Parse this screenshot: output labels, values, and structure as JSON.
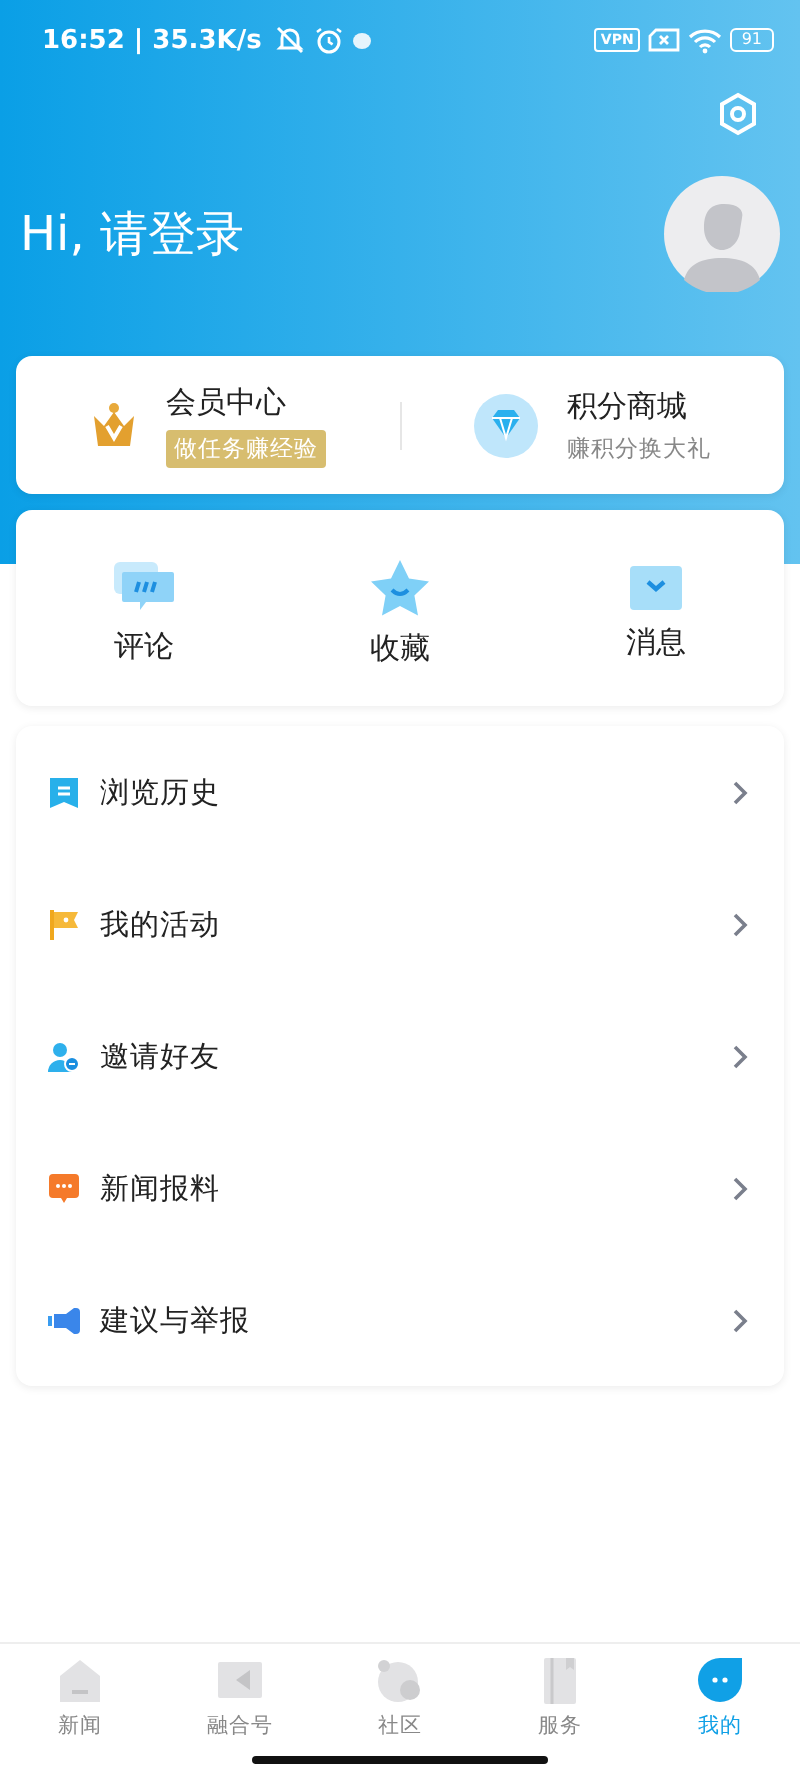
{
  "status_bar": {
    "time": "16:52 | 35.3K/s",
    "vpn": "VPN",
    "battery": "91"
  },
  "header": {
    "greeting": "Hi, 请登录"
  },
  "feature_cards": [
    {
      "kind": "member",
      "title": "会员中心",
      "subtitle": "做任务赚经验"
    },
    {
      "kind": "points",
      "title": "积分商城",
      "subtitle": "赚积分换大礼"
    }
  ],
  "shortcuts": [
    {
      "kind": "comment",
      "label": "评论"
    },
    {
      "kind": "favorite",
      "label": "收藏"
    },
    {
      "kind": "message",
      "label": "消息"
    }
  ],
  "menu": [
    {
      "kind": "history",
      "label": "浏览历史"
    },
    {
      "kind": "activity",
      "label": "我的活动"
    },
    {
      "kind": "invite",
      "label": "邀请好友"
    },
    {
      "kind": "tipoff",
      "label": "新闻报料"
    },
    {
      "kind": "feedback",
      "label": "建议与举报"
    }
  ],
  "bottom_nav": [
    {
      "kind": "news",
      "label": "新闻",
      "selected": false
    },
    {
      "kind": "video",
      "label": "融合号",
      "selected": false
    },
    {
      "kind": "community",
      "label": "社区",
      "selected": false
    },
    {
      "kind": "service",
      "label": "服务",
      "selected": false
    },
    {
      "kind": "mine",
      "label": "我的",
      "selected": true
    }
  ]
}
